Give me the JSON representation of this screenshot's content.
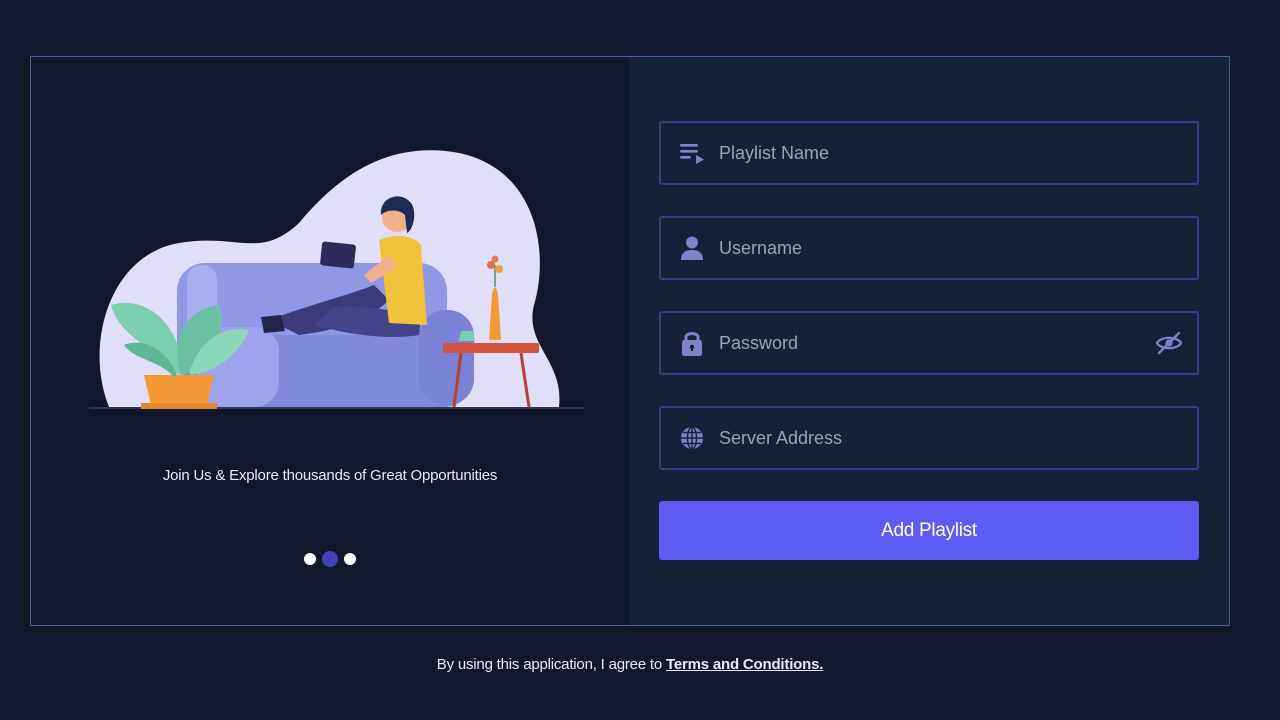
{
  "left": {
    "tagline": "Join Us & Explore thousands of Great Opportunities",
    "carousel": {
      "count": 3,
      "active_index": 1
    }
  },
  "form": {
    "playlist_name": {
      "placeholder": "Playlist Name",
      "value": "",
      "icon": "playlist-icon"
    },
    "username": {
      "placeholder": "Username",
      "value": "",
      "icon": "user-icon"
    },
    "password": {
      "placeholder": "Password",
      "value": "",
      "icon": "lock-icon",
      "toggle_icon": "eye-off-icon"
    },
    "server_address": {
      "placeholder": "Server Address",
      "value": "",
      "icon": "globe-icon"
    },
    "submit_label": "Add Playlist"
  },
  "footer": {
    "text": "By using this application, I agree to",
    "link_label": "Terms and Conditions."
  },
  "colors": {
    "background": "#12172b",
    "form_panel": "#172039",
    "accent": "#5c5cf4",
    "field_border": "#343d8a",
    "icon": "#7a85c8"
  }
}
